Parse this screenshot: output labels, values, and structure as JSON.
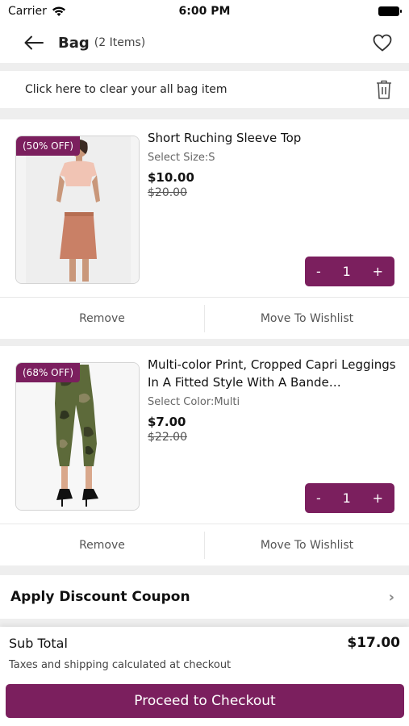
{
  "status_bar": {
    "carrier": "Carrier",
    "time": "6:00 PM"
  },
  "header": {
    "title": "Bag",
    "item_count": "(2 Items)"
  },
  "clear_bag": {
    "label": "Click here to clear your all bag item"
  },
  "items": [
    {
      "discount": "(50% OFF)",
      "name": "Short Ruching Sleeve Top",
      "variant": "Select Size:S",
      "price": "$10.00",
      "old_price": "$20.00",
      "qty_minus": "-",
      "quantity": "1",
      "qty_plus": "+",
      "remove_label": "Remove",
      "wishlist_label": "Move To Wishlist"
    },
    {
      "discount": "(68% OFF)",
      "name": "Multi-color Print, Cropped Capri Leggings In A Fitted Style With A Bande…",
      "variant": "Select Color:Multi",
      "price": "$7.00",
      "old_price": "$22.00",
      "qty_minus": "-",
      "quantity": "1",
      "qty_plus": "+",
      "remove_label": "Remove",
      "wishlist_label": "Move To Wishlist"
    }
  ],
  "coupon": {
    "label": "Apply Discount Coupon"
  },
  "summary": {
    "subtotal_label": "Sub Total",
    "subtotal_value": "$17.00",
    "tax_note": "Taxes and shipping calculated at checkout",
    "checkout_label": "Proceed to Checkout"
  },
  "colors": {
    "accent": "#7b1f5e",
    "background": "#eeeeee"
  }
}
